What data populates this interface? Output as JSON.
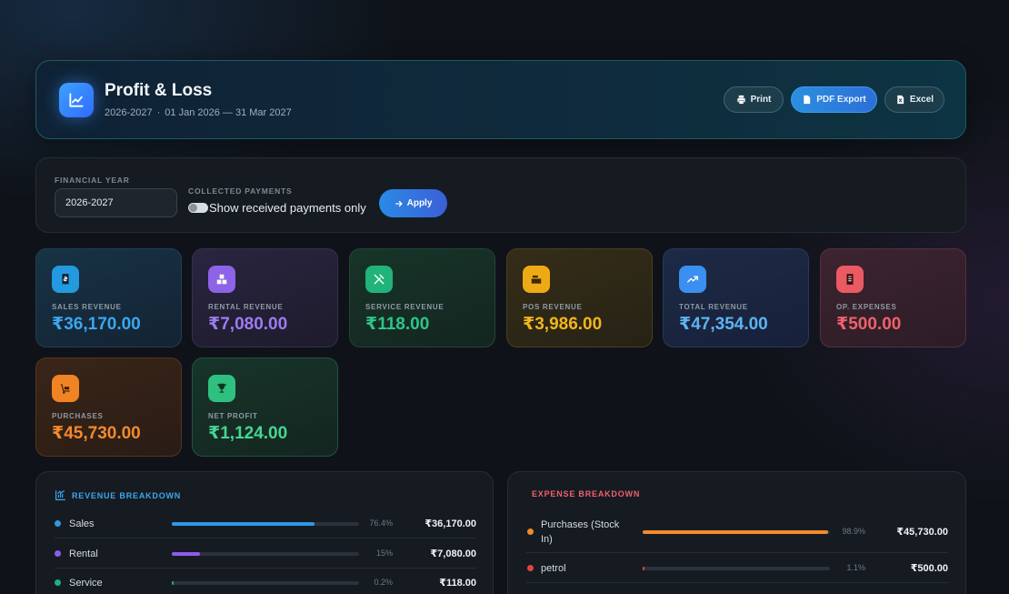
{
  "header": {
    "title": "Profit & Loss",
    "year": "2026-2027",
    "separator": "·",
    "range": "01 Jan 2026 — 31 Mar 2027",
    "icon": "chart-line-icon",
    "actions": {
      "print": "Print",
      "pdf": "PDF Export",
      "excel": "Excel"
    }
  },
  "filters": {
    "fy_label": "FINANCIAL YEAR",
    "fy_value": "2026-2027",
    "collected_label": "COLLECTED PAYMENTS",
    "toggle_label": "Show received payments only",
    "toggle_on": false,
    "apply": "Apply"
  },
  "cards": [
    {
      "label": "SALES REVENUE",
      "value": "₹36,170.00",
      "color": "#3aa7ee",
      "icon": "receipt-icon"
    },
    {
      "label": "RENTAL REVENUE",
      "value": "₹7,080.00",
      "color": "#9f7af0",
      "icon": "boxes-icon"
    },
    {
      "label": "SERVICE REVENUE",
      "value": "₹118.00",
      "color": "#2fc48a",
      "icon": "tools-icon"
    },
    {
      "label": "POS REVENUE",
      "value": "₹3,986.00",
      "color": "#f2b51c",
      "icon": "cash-register-icon"
    },
    {
      "label": "TOTAL REVENUE",
      "value": "₹47,354.00",
      "color": "#5cb4f2",
      "icon": "trend-up-icon"
    },
    {
      "label": "OP. EXPENSES",
      "value": "₹500.00",
      "color": "#f0606a",
      "icon": "document-icon"
    },
    {
      "label": "PURCHASES",
      "value": "₹45,730.00",
      "color": "#f3892e",
      "icon": "dolly-icon"
    },
    {
      "label": "NET PROFIT",
      "value": "₹1,124.00",
      "color": "#46d690",
      "icon": "trophy-icon"
    }
  ],
  "revenue_breakdown": {
    "title": "REVENUE BREAKDOWN",
    "color": "#3aa7ee",
    "rows": [
      {
        "name": "Sales",
        "pct": "76.4%",
        "share": 0.764,
        "amount": "₹36,170.00",
        "color": "#2f97e6"
      },
      {
        "name": "Rental",
        "pct": "15%",
        "share": 0.15,
        "amount": "₹7,080.00",
        "color": "#8d5bf0"
      },
      {
        "name": "Service",
        "pct": "0.2%",
        "share": 0.002,
        "amount": "₹118.00",
        "color": "#22b07a"
      }
    ]
  },
  "expense_breakdown": {
    "title": "EXPENSE BREAKDOWN",
    "color": "#f0606a",
    "rows": [
      {
        "name": "Purchases (Stock In)",
        "pct": "98.9%",
        "share": 0.989,
        "amount": "₹45,730.00",
        "color": "#f3892e"
      },
      {
        "name": "petrol",
        "pct": "1.1%",
        "share": 0.011,
        "amount": "₹500.00",
        "color": "#e8433f"
      }
    ]
  }
}
